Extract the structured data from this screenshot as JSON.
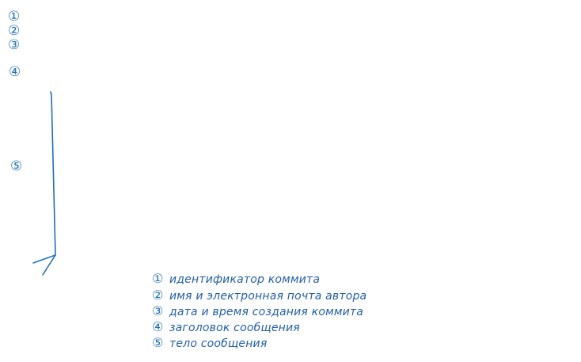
{
  "markers": [
    "①",
    "②",
    "③",
    "④",
    "⑤"
  ],
  "legend": [
    {
      "num": "①",
      "text": "идентификатор коммита"
    },
    {
      "num": "②",
      "text": "имя и электронная почта автора"
    },
    {
      "num": "③",
      "text": "дата и время создания коммита"
    },
    {
      "num": "④",
      "text": "заголовок сообщения"
    },
    {
      "num": "⑤",
      "text": "тело сообщения"
    }
  ],
  "colors": {
    "ink": "#1f6fb8"
  }
}
